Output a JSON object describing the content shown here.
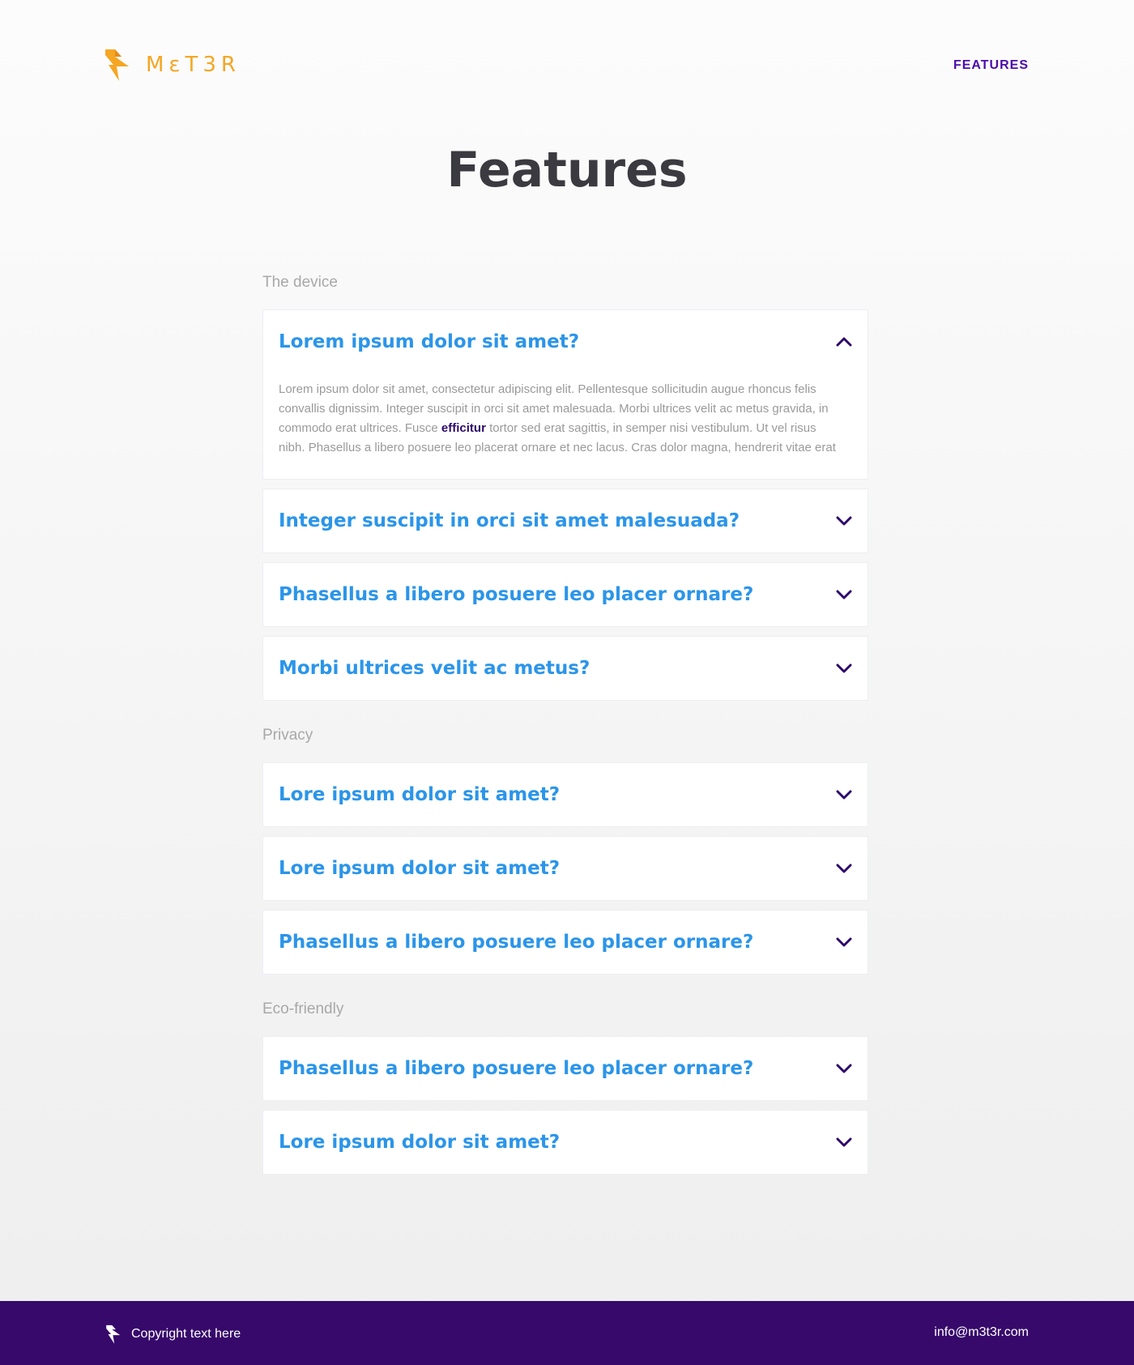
{
  "brand": {
    "name": "MεT3R",
    "accent_color": "#f5a623"
  },
  "nav": {
    "features_label": "FEATURES"
  },
  "page": {
    "title": "Features"
  },
  "sections": [
    {
      "label": "The device",
      "items": [
        {
          "question": "Lorem ipsum dolor sit amet?",
          "expanded": true,
          "answer_before": "Lorem ipsum dolor sit amet, consectetur adipiscing elit. Pellentesque sollicitudin augue rhoncus felis convallis dignissim. Integer suscipit in orci sit amet malesuada. Morbi ultrices velit ac metus gravida, in commodo erat ultrices. Fusce ",
          "answer_highlight": "efficitur",
          "answer_after": " tortor sed erat sagittis, in semper nisi vestibulum. Ut vel risus nibh. Phasellus a libero posuere leo placerat ornare et nec lacus. Cras dolor magna, hendrerit vitae erat"
        },
        {
          "question": "Integer suscipit in orci sit amet malesuada?",
          "expanded": false
        },
        {
          "question": "Phasellus a libero posuere leo placer ornare?",
          "expanded": false
        },
        {
          "question": "Morbi ultrices velit ac metus?",
          "expanded": false
        }
      ]
    },
    {
      "label": "Privacy",
      "items": [
        {
          "question": "Lore ipsum dolor sit amet?",
          "expanded": false
        },
        {
          "question": "Lore ipsum dolor sit amet?",
          "expanded": false
        },
        {
          "question": "Phasellus a libero posuere leo placer ornare?",
          "expanded": false
        }
      ]
    },
    {
      "label": "Eco-friendly",
      "items": [
        {
          "question": "Phasellus a libero posuere leo placer ornare?",
          "expanded": false
        },
        {
          "question": "Lore ipsum dolor sit amet?",
          "expanded": false
        }
      ]
    }
  ],
  "footer": {
    "copyright": "Copyright text here",
    "email": "info@m3t3r.com"
  },
  "icons": {
    "logo": "lightning-bolt-icon",
    "expanded": "chevron-up-icon",
    "collapsed": "chevron-down-icon"
  },
  "colors": {
    "question": "#2b95e9",
    "chevron": "#2e0a6b",
    "footer_bg": "#36096b",
    "nav": "#4a0dab"
  }
}
